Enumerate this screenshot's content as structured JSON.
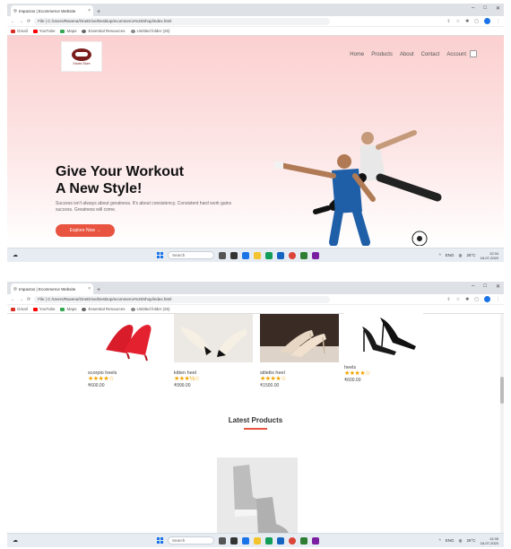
{
  "shots": [
    {
      "tab_title": "Impactos | Ecommerce Website",
      "url": "File | C:/Users/Ravena/OneDrive/Desktop/ecommerce%20Shop/index.html",
      "bookmarks": [
        "Gmail",
        "YouTube",
        "Maps",
        "Essential Resources",
        "Untitled folder (25)"
      ],
      "window_controls": [
        "–",
        "□",
        "✕"
      ],
      "hero": {
        "logo_text": "Shoes Store",
        "nav": [
          "Home",
          "Products",
          "About",
          "Contact",
          "Account"
        ],
        "title_line1": "Give Your Workout",
        "title_line2": "A New Style!",
        "subtitle": "Success isn't always about greatness. It's about consistency. Consistent hard work gains success. Greatness will come.",
        "button": "Explore Now →"
      },
      "taskbar": {
        "search": "Search",
        "weather": "26°C",
        "lang": "ENG",
        "time": "12:34",
        "date": "18-07-2020"
      }
    },
    {
      "tab_title": "Impactos | Ecommerce Website",
      "url": "File | C:/Users/Ravena/OneDrive/Desktop/ecommerce%20Shop/index.html",
      "bookmarks": [
        "Gmail",
        "YouTube",
        "Maps",
        "Essential Resources",
        "Untitled folder (25)"
      ],
      "window_controls": [
        "–",
        "□",
        "✕"
      ],
      "products": [
        {
          "name": "scorpio heels",
          "stars": "★★★★☆",
          "price": "₹600.00"
        },
        {
          "name": "kitten heel",
          "stars": "★★★½☆",
          "price": "₹999.00"
        },
        {
          "name": "stiletto heel",
          "stars": "★★★★☆",
          "price": "₹1500.00"
        },
        {
          "name": "heels",
          "stars": "★★★★☆",
          "price": "₹600.00"
        }
      ],
      "section_title": "Latest Products",
      "taskbar": {
        "search": "Search",
        "weather": "26°C",
        "lang": "ENG",
        "time": "12:35",
        "date": "18-07-2020"
      }
    }
  ],
  "colors": {
    "accent": "#e8543f",
    "hero_pink": "#fbd0d0",
    "stars": "#f0a500"
  }
}
